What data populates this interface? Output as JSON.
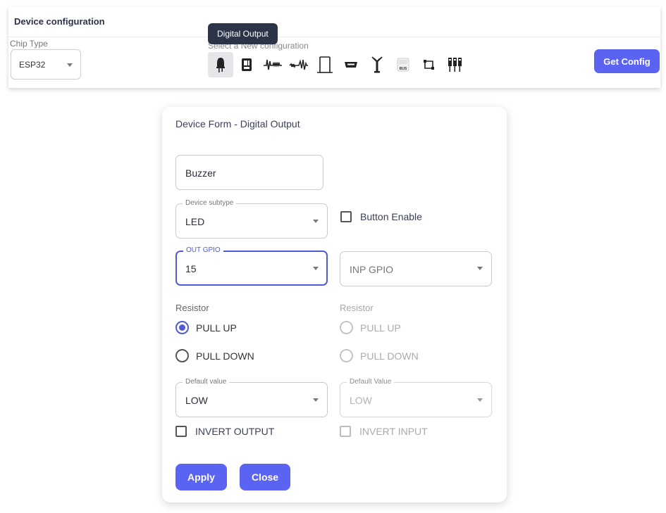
{
  "config": {
    "title": "Device configuration",
    "chip_type_label": "Chip Type",
    "chip_type_value": "ESP32",
    "select_label": "Select a New configuration",
    "tooltip": "Digital Output",
    "get_config_label": "Get Config",
    "icons": [
      {
        "name": "digital-output-icon",
        "active": true
      },
      {
        "name": "digital-input-icon",
        "active": false
      },
      {
        "name": "pwm-signal-icon",
        "active": false
      },
      {
        "name": "analog-signal-icon",
        "active": false
      },
      {
        "name": "pulse-waveform-icon",
        "active": false
      },
      {
        "name": "serial-port-icon",
        "active": false
      },
      {
        "name": "antenna-icon",
        "active": false
      },
      {
        "name": "bus-icon",
        "active": false
      },
      {
        "name": "i2c-connection-icon",
        "active": false
      },
      {
        "name": "multi-pin-connector-icon",
        "active": false
      }
    ],
    "bus_icon_text": "BUS"
  },
  "form": {
    "title": "Device Form - Digital Output",
    "device_name": "Buzzer",
    "device_subtype_label": "Device subtype",
    "device_subtype_value": "LED",
    "button_enable_label": "Button Enable",
    "out_gpio_label": "OUT GPIO",
    "out_gpio_value": "15",
    "inp_gpio_placeholder": "INP GPIO",
    "resistor_label_left": "Resistor",
    "resistor_label_right": "Resistor",
    "pull_up_left": "PULL UP",
    "pull_down_left": "PULL DOWN",
    "pull_up_right": "PULL UP",
    "pull_down_right": "PULL DOWN",
    "default_value_label_left": "Default value",
    "default_value_left": "LOW",
    "default_value_label_right": "Default Value",
    "default_value_right": "LOW",
    "invert_output_label": "INVERT OUTPUT",
    "invert_input_label": "INVERT INPUT",
    "apply_label": "Apply",
    "close_label": "Close"
  },
  "colors": {
    "accent": "#5b63f2",
    "focus": "#4f5bd5",
    "tooltip_bg": "#2c3447"
  }
}
